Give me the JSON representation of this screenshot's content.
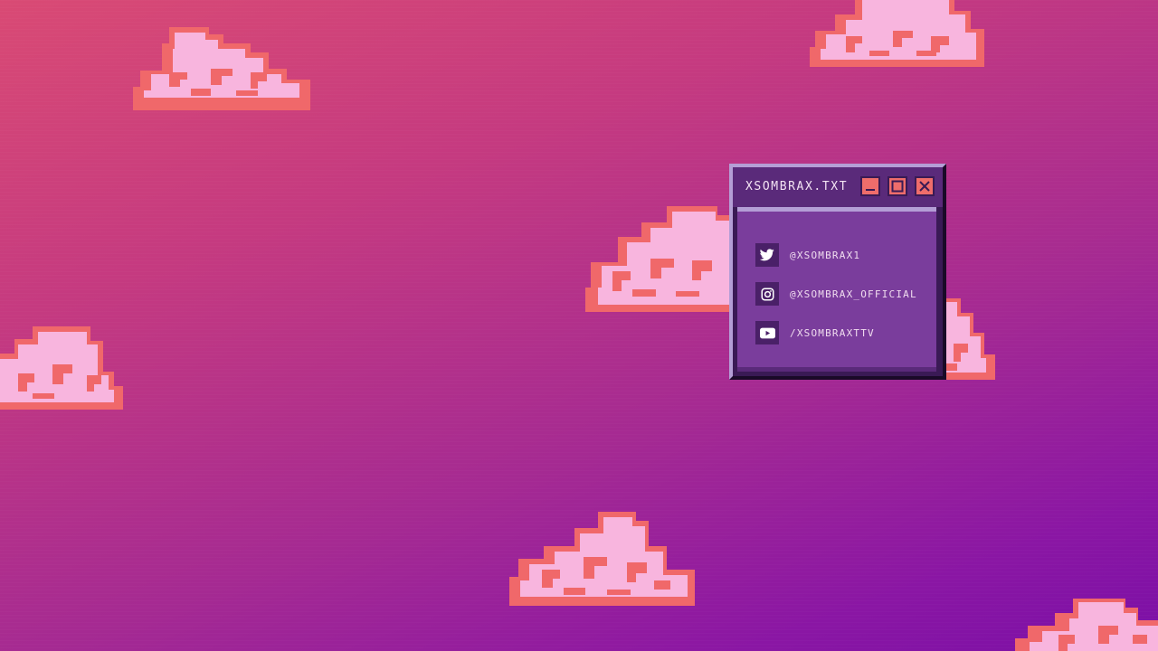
{
  "colors": {
    "background_top": "#d94a74",
    "background_bottom": "#7b0fa6",
    "cloud_body": "#f8b5de",
    "cloud_outline": "#f0686a",
    "window_frame": "#3a1a55",
    "window_titlebar": "#5a2a7a",
    "window_content": "#7a3d9c",
    "window_accent": "#b49ed6",
    "window_button": "#ef6d6b"
  },
  "window": {
    "title": "XSOMBRAX.TXT",
    "buttons": [
      "minimize-icon",
      "maximize-icon",
      "close-icon"
    ],
    "social_links": [
      {
        "icon": "twitter-icon",
        "handle": "@XSOMBRAX1"
      },
      {
        "icon": "instagram-icon",
        "handle": "@XSOMBRAX_OFFICIAL"
      },
      {
        "icon": "youtube-icon",
        "handle": "/XSOMBRAXTTV"
      }
    ]
  }
}
